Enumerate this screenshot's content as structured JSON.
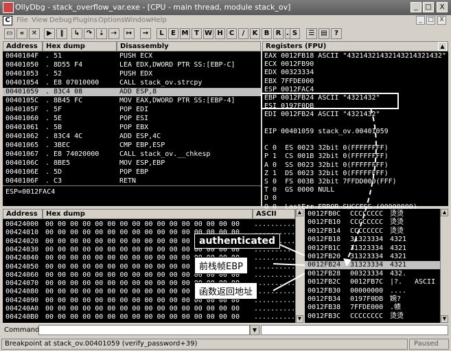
{
  "window": {
    "title": "OllyDbg - stack_overflow_var.exe - [CPU - main thread, module stack_ov]",
    "controls": [
      "_",
      "□",
      "X"
    ]
  },
  "menu": {
    "items": [
      "File",
      "View",
      "Debug",
      "Plugins",
      "Options",
      "Window",
      "Help"
    ],
    "mdi_controls": [
      "_",
      "□",
      "X"
    ]
  },
  "toolbar": {
    "letters": [
      "L",
      "E",
      "M",
      "T",
      "W",
      "H",
      "C",
      "/",
      "K",
      "B",
      "R",
      "...",
      "S"
    ],
    "help": "?"
  },
  "disasm": {
    "headers": [
      "Address",
      "Hex dump",
      "Disassembly"
    ],
    "rows": [
      {
        "addr": "0040104F",
        "hex": ". 51",
        "asm": "PUSH ECX"
      },
      {
        "addr": "00401050",
        "hex": ". 8D55 F4",
        "asm": "LEA EDX,DWORD PTR SS:[EBP-C]"
      },
      {
        "addr": "00401053",
        "hex": ". 52",
        "asm": "PUSH EDX"
      },
      {
        "addr": "00401054",
        "hex": ". E8 07010000",
        "asm": "CALL stack_ov.strcpy"
      },
      {
        "addr": "00401059",
        "hex": ". 83C4 08",
        "asm": "ADD ESP,8"
      },
      {
        "addr": "0040105C",
        "hex": ". 8B45 FC",
        "asm": "MOV EAX,DWORD PTR SS:[EBP-4]"
      },
      {
        "addr": "0040105F",
        "hex": ". 5F",
        "asm": "POP EDI"
      },
      {
        "addr": "00401060",
        "hex": ". 5E",
        "asm": "POP ESI"
      },
      {
        "addr": "00401061",
        "hex": ". 5B",
        "asm": "POP EBX"
      },
      {
        "addr": "00401062",
        "hex": ". 83C4 4C",
        "asm": "ADD ESP,4C"
      },
      {
        "addr": "00401065",
        "hex": ". 3BEC",
        "asm": "CMP EBP,ESP"
      },
      {
        "addr": "00401067",
        "hex": ". E8 74020000",
        "asm": "CALL stack_ov.__chkesp"
      },
      {
        "addr": "0040106C",
        "hex": ". 8BE5",
        "asm": "MOV ESP,EBP"
      },
      {
        "addr": "0040106E",
        "hex": ". 5D",
        "asm": "POP EBP"
      },
      {
        "addr": "0040106F",
        "hex": ". C3",
        "asm": "RETN"
      }
    ],
    "info": "ESP=0012FAC4"
  },
  "registers": {
    "header": "Registers (FPU)",
    "lines": [
      "EAX 0012FB18 ASCII \"43214321432143214321432\"",
      "ECX 0012FB90",
      "EDX 00323334",
      "EBX 7FFDE000",
      "ESP 0012FAC4",
      "EBP 0012FB24 ASCII \"4321432\"",
      "ESI 0197F0DB",
      "EDI 0012FB24 ASCII \"4321432\"",
      "",
      "EIP 00401059 stack_ov.00401059",
      "",
      "C 0  ES 0023 32bit 0(FFFFFFFF)",
      "P 1  CS 001B 32bit 0(FFFFFFFF)",
      "A 0  SS 0023 32bit 0(FFFFFFFF)",
      "Z 1  DS 0023 32bit 0(FFFFFFFF)",
      "S 0  FS 003B 32bit 7FFDD000(FFF)",
      "T 0  GS 0000 NULL",
      "D 0",
      "O 0  LastErr ERROR_SUCCESS (00000000)"
    ]
  },
  "dump": {
    "headers": [
      "Address",
      "Hex dump",
      "ASCII"
    ],
    "hex": "00 00 00 00 00 00 00 00 00 00 00 00 00 00 00 00",
    "ascii": "................",
    "addresses": [
      "00424000",
      "00424010",
      "00424020",
      "00424030",
      "00424040",
      "00424050",
      "00424060",
      "00424070",
      "00424080",
      "00424090",
      "004240A0",
      "004240B0"
    ]
  },
  "stack": {
    "rows": [
      {
        "addr": "0012FB0C",
        "val": "CCCCCCCC",
        "txt": "烫烫"
      },
      {
        "addr": "0012FB10",
        "val": "CCCCCCCC",
        "txt": "烫烫"
      },
      {
        "addr": "0012FB14",
        "val": "CCCCCCCC",
        "txt": "烫烫"
      },
      {
        "addr": "0012FB18",
        "val": "31323334",
        "txt": "4321"
      },
      {
        "addr": "0012FB1C",
        "val": "31323334",
        "txt": "4321"
      },
      {
        "addr": "0012FB20",
        "val": "31323334",
        "txt": "4321"
      },
      {
        "addr": "0012FB24",
        "val": "31323334",
        "txt": "4321"
      },
      {
        "addr": "0012FB28",
        "val": "00323334",
        "txt": "432."
      },
      {
        "addr": "0012FB2C",
        "val": "0012FB7C",
        "txt": "|?.",
        "extra": "ASCII"
      },
      {
        "addr": "0012FB30",
        "val": "00000000",
        "txt": "...."
      },
      {
        "addr": "0012FB34",
        "val": "0197F0DB",
        "txt": "婉?"
      },
      {
        "addr": "0012FB38",
        "val": "7FFDE000",
        "txt": ".帻"
      },
      {
        "addr": "0012FB3C",
        "val": "CCCCCCCC",
        "txt": "烫烫"
      }
    ]
  },
  "annotations": {
    "authenticated": "authenticated",
    "prev_ebp": "前栈帧EBP",
    "ret_addr": "函数返回地址"
  },
  "command": {
    "label": "Command :",
    "value": ""
  },
  "status": {
    "message": "Breakpoint at stack_ov.00401059 (verify_password+39)",
    "state": "Paused"
  },
  "colors": {
    "pane_bg": "#000000",
    "pane_fg": "#ffffff",
    "selection": "#c0c0c0",
    "chrome": "#d4d0c8"
  }
}
